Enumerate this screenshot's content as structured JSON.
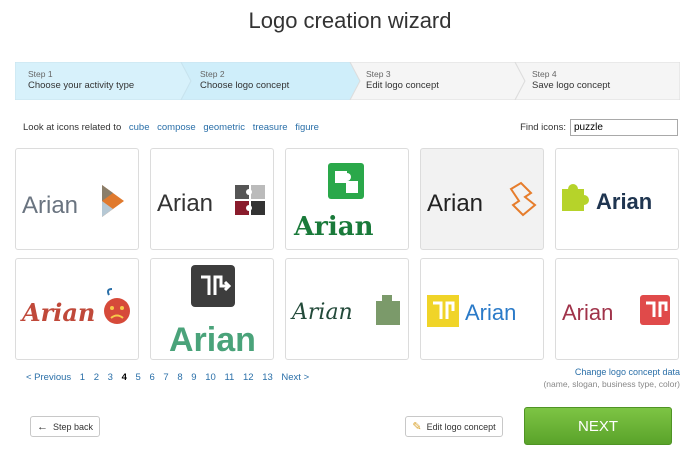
{
  "page": {
    "title": "Logo creation wizard"
  },
  "steps": [
    {
      "num": "Step 1",
      "label": "Choose your activity type"
    },
    {
      "num": "Step 2",
      "label": "Choose logo concept"
    },
    {
      "num": "Step 3",
      "label": "Edit logo concept"
    },
    {
      "num": "Step 4",
      "label": "Save logo concept"
    }
  ],
  "related": {
    "prefix": "Look at icons related to",
    "links": [
      "cube",
      "compose",
      "geometric",
      "treasure",
      "figure"
    ]
  },
  "find": {
    "label": "Find icons:",
    "value": "puzzle"
  },
  "tiles": [
    {
      "text": "Arian",
      "icon": "play-triangle-icon"
    },
    {
      "text": "Arian",
      "icon": "puzzle-squares-icon"
    },
    {
      "text": "Arian",
      "icon": "green-puzzle-icon"
    },
    {
      "text": "Arian",
      "icon": "orange-puzzle-outline-icon"
    },
    {
      "text": "Arian",
      "icon": "lime-puzzle-icon"
    },
    {
      "text": "Arian",
      "icon": "sad-face-icon"
    },
    {
      "text": "Arian",
      "icon": "arrow-puzzle-icon"
    },
    {
      "text": "Arian",
      "icon": "green-puzzle-piece-icon"
    },
    {
      "text": "Arian",
      "icon": "yellow-puzzle-icon"
    },
    {
      "text": "Arian",
      "icon": "red-puzzle-icon"
    }
  ],
  "pager": {
    "prev": "< Previous",
    "pages": [
      "1",
      "2",
      "3",
      "4",
      "5",
      "6",
      "7",
      "8",
      "9",
      "10",
      "11",
      "12",
      "13"
    ],
    "current": "4",
    "next": "Next >"
  },
  "change": {
    "link": "Change logo concept data",
    "sub": "(name, slogan, business type, color)"
  },
  "buttons": {
    "back": "Step back",
    "edit": "Edit logo concept",
    "next": "NEXT"
  },
  "colors": {
    "accent_green": "#6ab536",
    "step_active": "#cfeefa",
    "link": "#2a6fa8"
  }
}
